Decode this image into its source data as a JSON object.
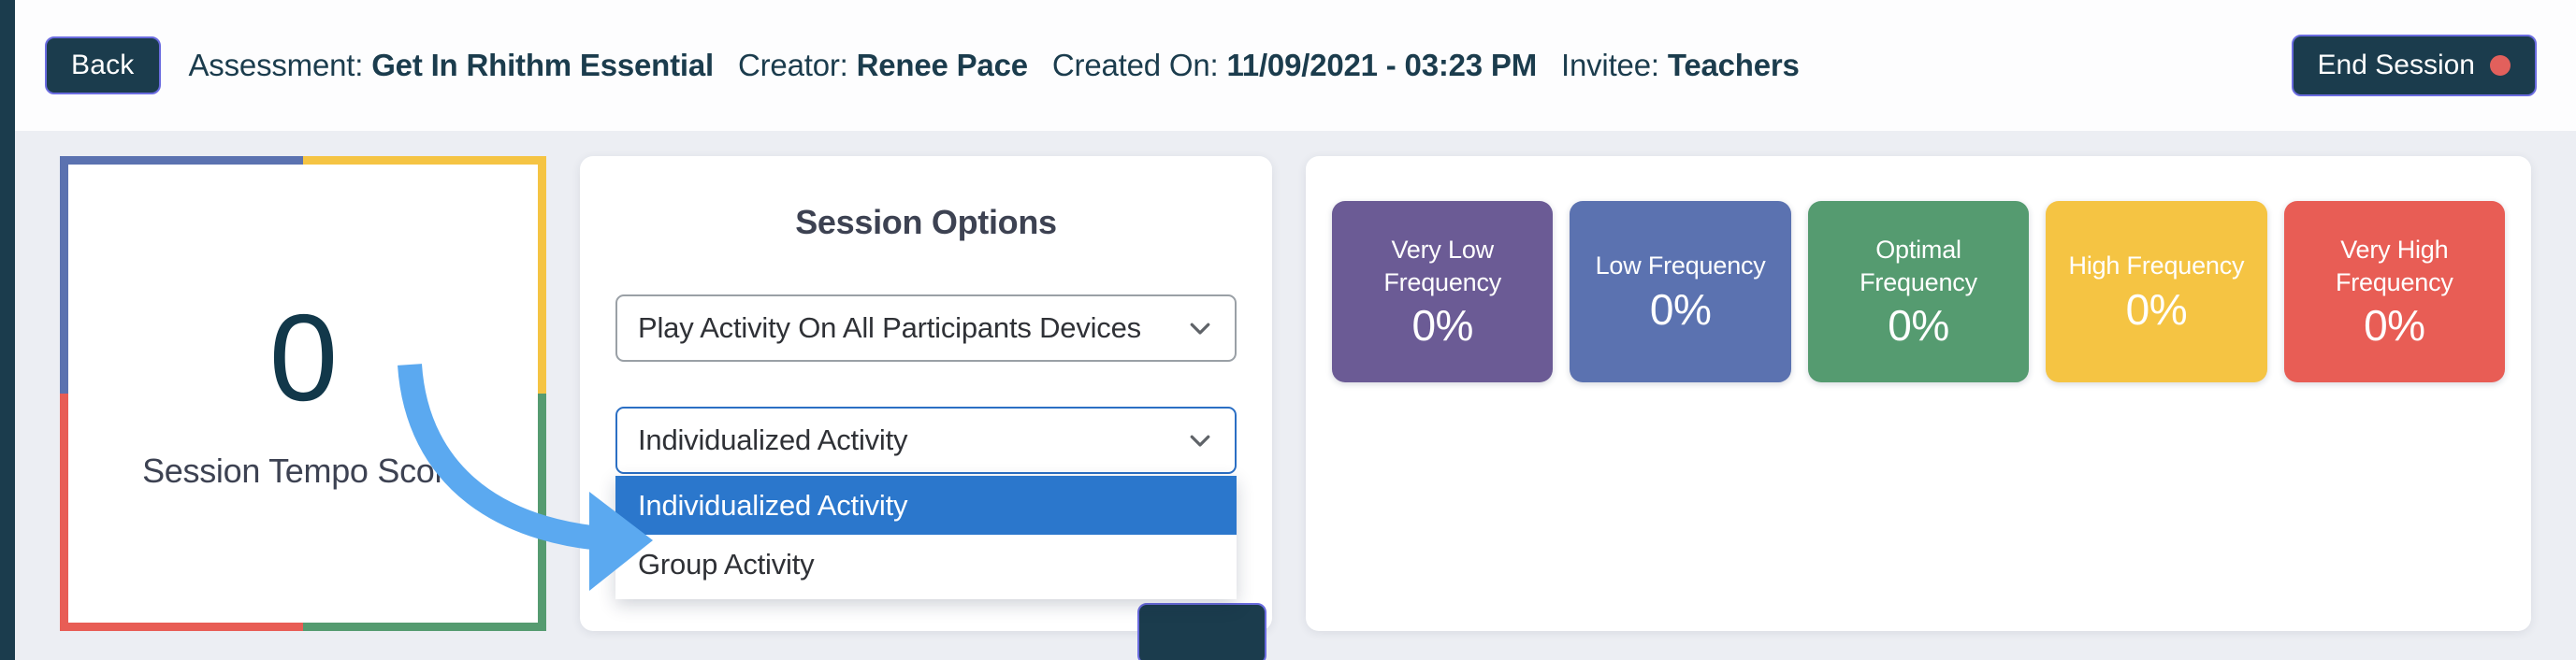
{
  "header": {
    "back_label": "Back",
    "assessment_label": "Assessment:",
    "assessment_value": "Get In Rhithm Essential",
    "creator_label": "Creator:",
    "creator_value": "Renee Pace",
    "created_on_label": "Created On:",
    "created_on_value": "11/09/2021 - 03:23 PM",
    "invitee_label": "Invitee:",
    "invitee_value": "Teachers",
    "end_session_label": "End Session",
    "end_session_dot_color": "#e2605c",
    "button_bg_color": "#1b3c4d",
    "button_border_color": "#6b6ce0"
  },
  "tempo_card": {
    "value": "0",
    "label": "Session Tempo Score",
    "edge_colors": {
      "top_left": "#5b72b0",
      "top_right": "#f5c443",
      "bottom_left": "#e85d55",
      "bottom_right": "#559b70"
    }
  },
  "annotation": {
    "arrow_color": "#5ba9f0",
    "points_to": "activity-type-select"
  },
  "session_options": {
    "title": "Session Options",
    "playback_select": {
      "value": "Play Activity On All Participants Devices",
      "icon": "chevron-down-icon",
      "state": "closed"
    },
    "activity_select": {
      "value": "Individualized Activity",
      "icon": "chevron-down-icon",
      "state": "open",
      "options": [
        {
          "label": "Individualized Activity",
          "selected": true
        },
        {
          "label": "Group Activity",
          "selected": false
        }
      ]
    }
  },
  "frequency": {
    "cards": [
      {
        "name": "Very Low Frequency",
        "value": "0%",
        "color": "#6b5b95"
      },
      {
        "name": "Low Frequency",
        "value": "0%",
        "color": "#5b72b0"
      },
      {
        "name": "Optimal Frequency",
        "value": "0%",
        "color": "#559b70"
      },
      {
        "name": "High Frequency",
        "value": "0%",
        "color": "#f5c443"
      },
      {
        "name": "Very High Frequency",
        "value": "0%",
        "color": "#e85d55"
      }
    ]
  }
}
